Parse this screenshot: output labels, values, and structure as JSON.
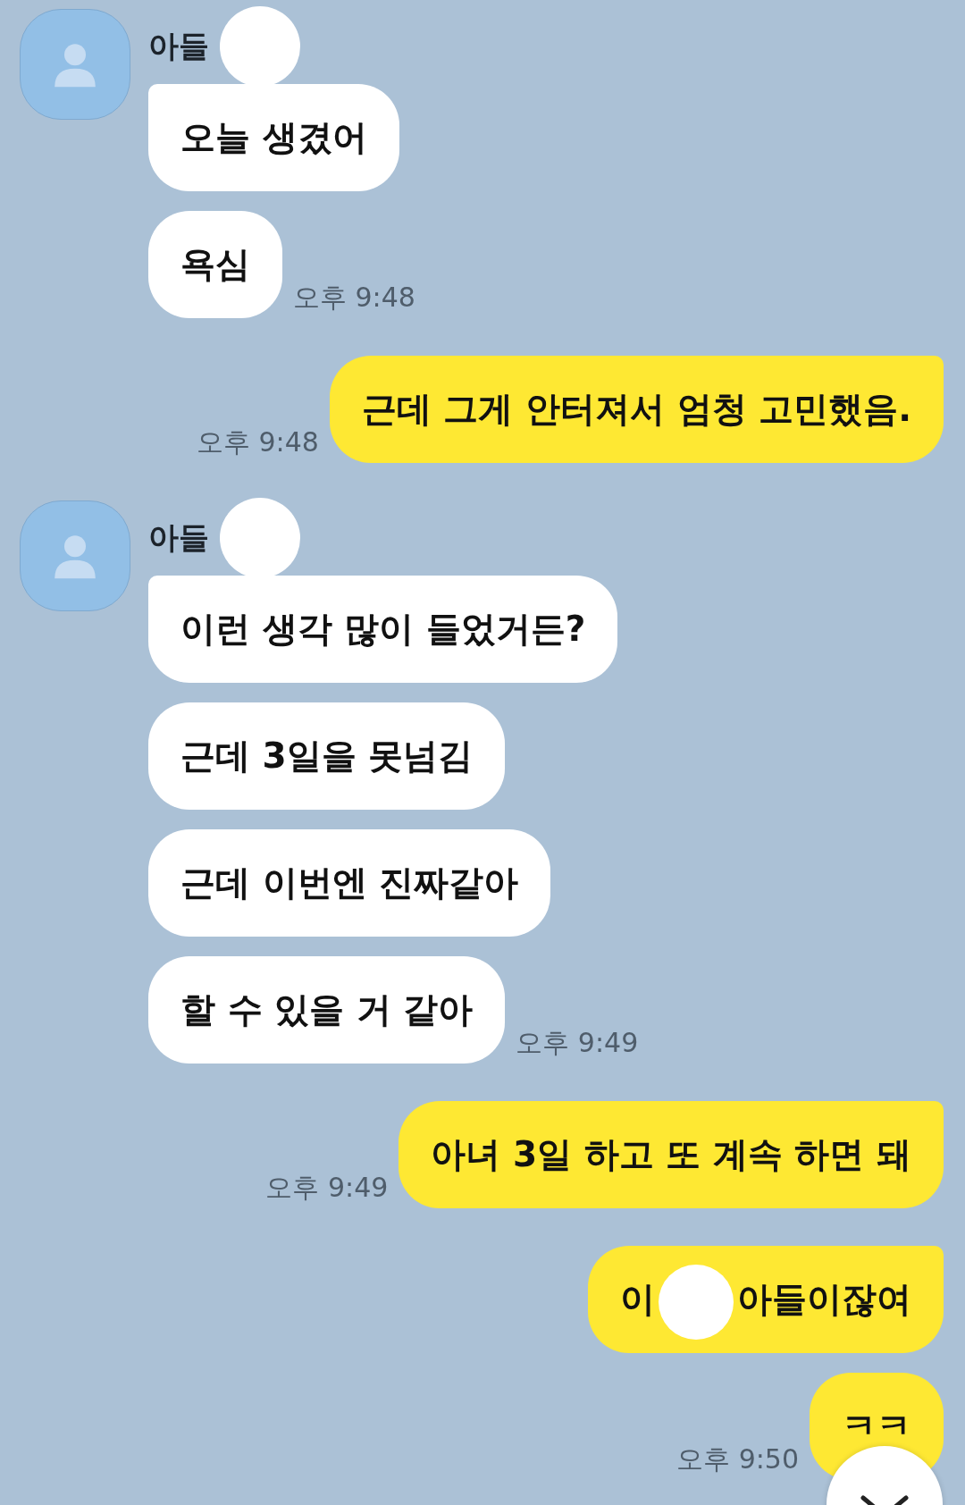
{
  "groups": [
    {
      "kind": "received",
      "sender": "아들",
      "messages": [
        {
          "parts": [
            "오늘 생겼어"
          ]
        },
        {
          "parts": [
            "욕심"
          ]
        }
      ],
      "time": "오후 9:48"
    },
    {
      "kind": "sent",
      "messages": [
        {
          "parts": [
            "근데 그게 안터져서 엄청 고민했음."
          ]
        }
      ],
      "time": "오후 9:48"
    },
    {
      "kind": "received",
      "sender": "아들",
      "messages": [
        {
          "parts": [
            "이런 생각 많이 들었거든?"
          ]
        },
        {
          "parts": [
            "근데 3일을 못넘김"
          ]
        },
        {
          "parts": [
            "근데 이번엔 진짜같아"
          ]
        },
        {
          "parts": [
            "할 수 있을 거 같아"
          ]
        }
      ],
      "time": "오후 9:49"
    },
    {
      "kind": "sent",
      "messages": [
        {
          "parts": [
            "아녀 3일 하고 또 계속 하면 돼"
          ]
        }
      ],
      "time": "오후 9:49"
    },
    {
      "kind": "sent",
      "messages": [
        {
          "parts": [
            "이",
            "아들이잖여"
          ]
        },
        {
          "parts": [
            "ㅋㅋ"
          ]
        }
      ],
      "time": "오후 9:50"
    }
  ]
}
